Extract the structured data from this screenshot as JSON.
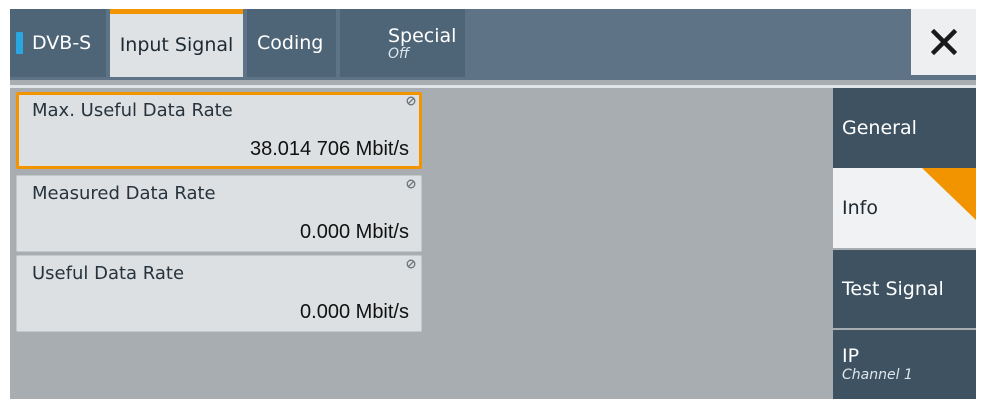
{
  "tabs": {
    "dvbs": {
      "label": "DVB-S"
    },
    "input_signal": {
      "label": "Input Signal"
    },
    "coding": {
      "label": "Coding"
    },
    "special": {
      "label": "Special",
      "sub": "Off"
    }
  },
  "close_icon": "close-icon",
  "fields": [
    {
      "label": "Max. Useful Data Rate",
      "value": "38.014 706 Mbit/s"
    },
    {
      "label": "Measured Data Rate",
      "value": "0.000 Mbit/s"
    },
    {
      "label": "Useful Data Rate",
      "value": "0.000 Mbit/s"
    }
  ],
  "side_menu": [
    {
      "label": "General"
    },
    {
      "label": "Info"
    },
    {
      "label": "Test Signal"
    },
    {
      "label": "IP",
      "sub": "Channel 1"
    }
  ],
  "colors": {
    "accent": "#f29400",
    "tab_dark": "#4e6577",
    "side_dark": "#3e5261",
    "indicator": "#2aa6e0"
  }
}
